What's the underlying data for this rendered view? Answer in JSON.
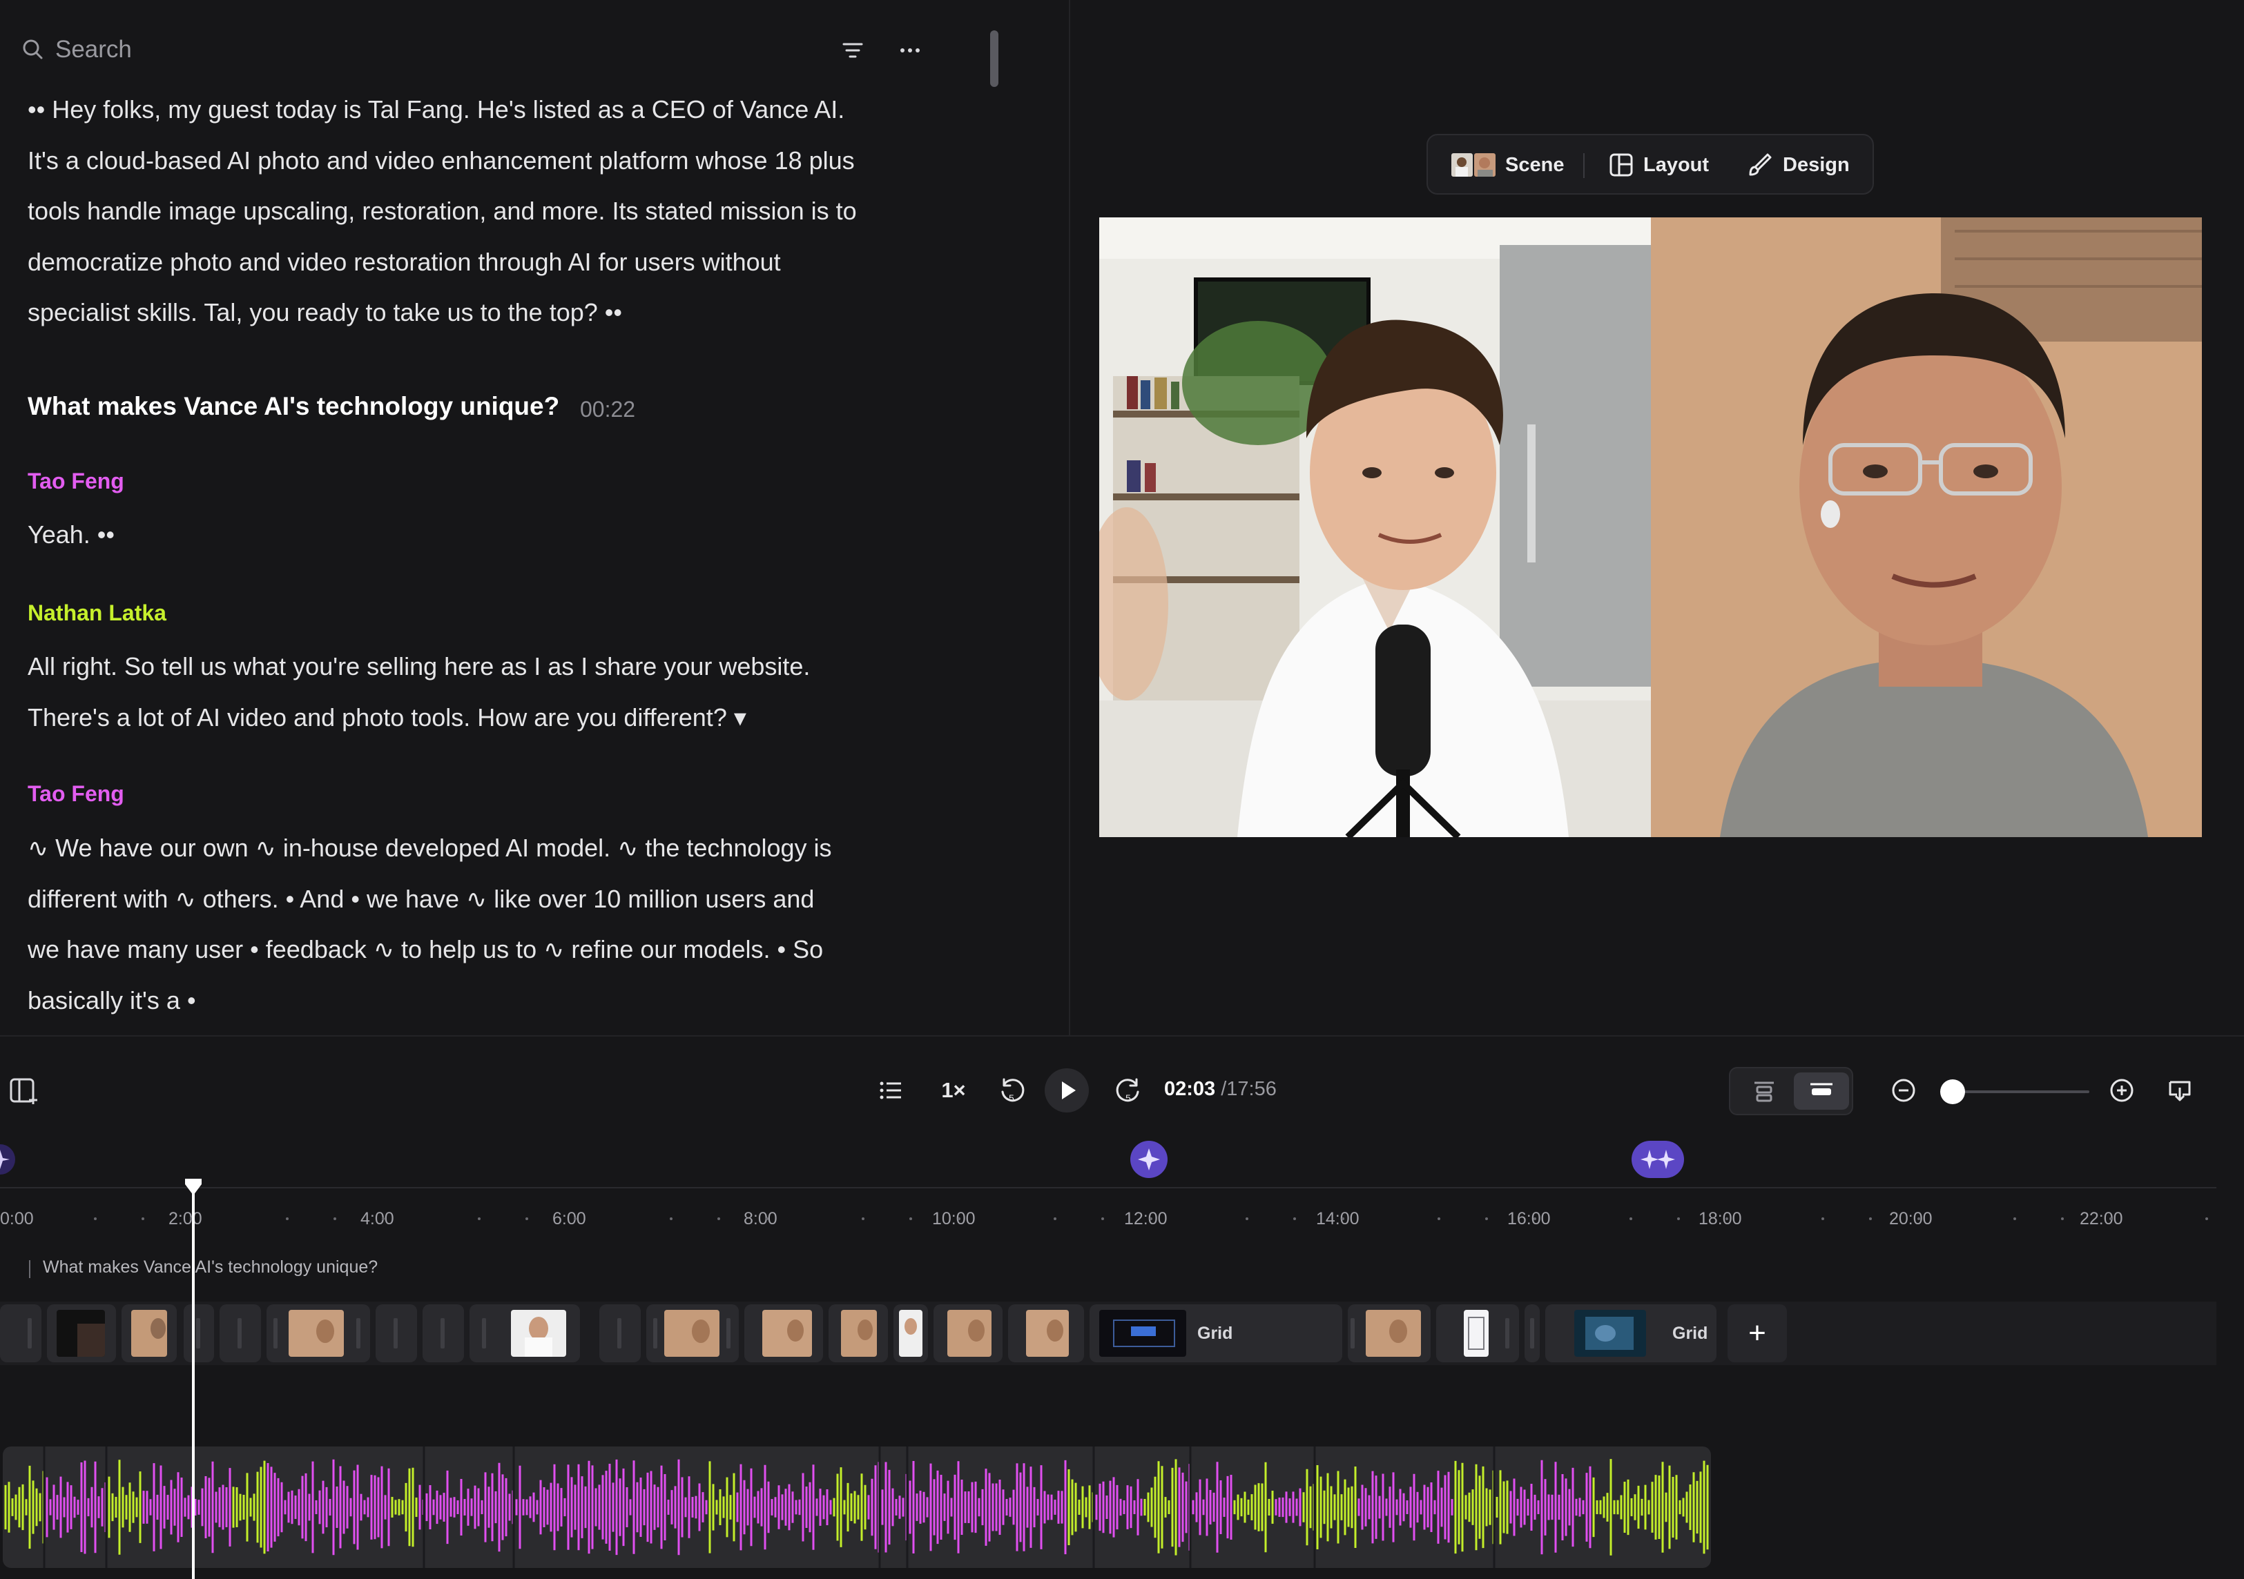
{
  "search": {
    "placeholder": "Search"
  },
  "transcript": {
    "intro_lines": [
      "•• Hey folks, my guest today is Tal Fang. He's listed as a CEO of Vance AI.",
      "It's a cloud-based AI photo and video enhancement platform whose 18 plus",
      "tools handle image upscaling, restoration, and more. Its stated mission is to",
      "democratize photo and video restoration through AI for users without",
      "specialist skills. Tal, you ready to take us to the top? ••"
    ],
    "chapter": {
      "title": "What makes Vance AI's technology unique?",
      "time": "00:22"
    },
    "blocks": [
      {
        "speaker": "Tao Feng",
        "lines": [
          "Yeah. ••"
        ]
      },
      {
        "speaker": "Nathan Latka",
        "lines": [
          "All right. So tell us what you're selling here as I as I share your website.",
          "There's a lot of AI video and photo tools. How are you different? ▾"
        ]
      },
      {
        "speaker": "Tao Feng",
        "lines": [
          "∿ We have our own ∿ in-house developed AI model. ∿ the technology is",
          "different with ∿ others. • And • we have ∿ like over 10 million users and",
          "we have many user • feedback ∿ to help us to ∿ refine our models. • So",
          "basically it's a •"
        ]
      }
    ]
  },
  "preview": {
    "modes": [
      {
        "label": "Scene",
        "icon": "scene-thumbnail-icon"
      },
      {
        "label": "Layout",
        "icon": "layout-icon"
      },
      {
        "label": "Design",
        "icon": "brush-icon"
      }
    ]
  },
  "playback": {
    "speed": "1×",
    "rewind_seconds": "5",
    "forward_seconds": "5",
    "current_time": "02:03",
    "total_time": "/17:56",
    "zoom_level": 0.1
  },
  "timeline": {
    "ruler_labels": [
      "0:00",
      "2:00",
      "4:00",
      "6:00",
      "8:00",
      "10:00",
      "12:00",
      "14:00",
      "16:00",
      "18:00",
      "20:00",
      "22:00"
    ],
    "chapter_marker": "What makes Vance AI's technology unique?",
    "grid_labels": [
      "Grid",
      "Grid"
    ],
    "add_label": "+"
  },
  "colors": {
    "speaker_tao": "#e25df0",
    "speaker_nathan": "#c6f02c",
    "wave_pink": "#e04ff0",
    "wave_lime": "#c3ee2a",
    "ai_marker": "#6a4fd6"
  }
}
